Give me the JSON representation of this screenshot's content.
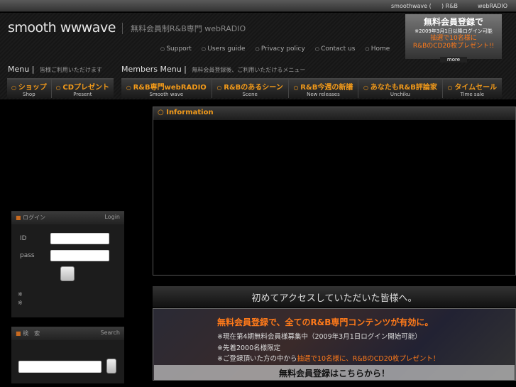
{
  "topbar": {
    "site": "smoothwave (",
    "rb": ") R&B",
    "radio": "webRADIO"
  },
  "header": {
    "logo": "smooth wwwave",
    "tagline": "無料会員制R&B専門 webRADIO",
    "links": [
      "Support",
      "Users guide",
      "Privacy policy",
      "Contact us",
      "Home"
    ],
    "promo": {
      "title": "無料会員登録で",
      "note": "※2009年3月1日以降ログイン可能",
      "line1": "抽選で10名様に",
      "line2": "R&BのCD20枚プレゼント!!",
      "more": "more"
    }
  },
  "menu": {
    "title": "Menu",
    "subtitle": "皆様ご利用いただけます",
    "items": [
      {
        "jp": "ショップ",
        "en": "Shop"
      },
      {
        "jp": "CDプレゼント",
        "en": "Present"
      }
    ]
  },
  "members_menu": {
    "title": "Members Menu",
    "subtitle": "無料会員登録後、ご利用いただけるメニュー",
    "items": [
      {
        "jp": "R&B専門webRADIO",
        "en": "Smooth wave"
      },
      {
        "jp": "R&Bのあるシーン",
        "en": "Scene"
      },
      {
        "jp": "R&B今週の新譜",
        "en": "New releases"
      },
      {
        "jp": "あなたもR&B評論家",
        "en": "Unchiku"
      },
      {
        "jp": "タイムセール",
        "en": "Time sale"
      }
    ]
  },
  "information": {
    "title": "Information"
  },
  "login": {
    "title_jp": "ログイン",
    "title_en": "Login",
    "id_label": "ID",
    "pass_label": "pass",
    "note1": "※",
    "note2": "※"
  },
  "search": {
    "title_jp": "検　索",
    "title_en": "Search"
  },
  "welcome": {
    "title": "初めてアクセスしていただいた皆様へ。",
    "headline": "無料会員登録で、全てのR&B専門コンテンツが有効に。",
    "line1": "※現在第4期無料会員様募集中（2009年3月1日ログイン開始可能）",
    "line2": "※先着2000名様限定",
    "line3a": "※ご登録頂いた方の中から",
    "line3b": "抽選で10名様に、R&BのCD20枚プレゼント！",
    "cta": "無料会員登録はこちらから！"
  }
}
